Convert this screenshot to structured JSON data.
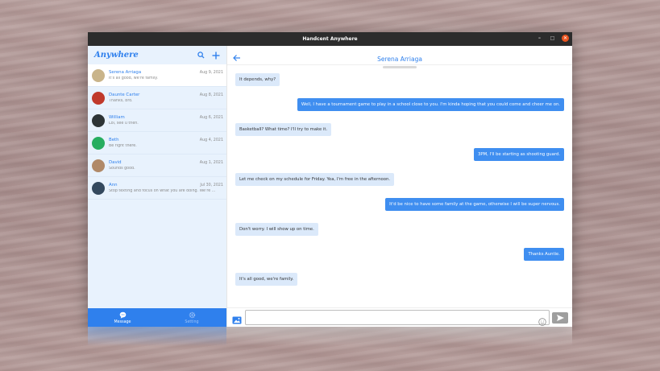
{
  "window": {
    "title": "Handcent Anywhere",
    "controls": [
      "minimize-icon",
      "maximize-icon",
      "close-icon"
    ],
    "close_symbol": "✕",
    "minimize_symbol": "–",
    "maximize_symbol": "□"
  },
  "sidebar": {
    "brand": "Anywhere",
    "search_icon": "search-icon",
    "add_icon": "plus-icon",
    "conversations": [
      {
        "name": "Serena Arriaga",
        "date": "Aug 9, 2021",
        "snippet": "It's all good, we're family.",
        "active": true,
        "avatar_color": "#c9b48a"
      },
      {
        "name": "Daunte Carter",
        "date": "Aug 8, 2021",
        "snippet": "Thanks, bro.",
        "active": false,
        "avatar_color": "#c0392b"
      },
      {
        "name": "William",
        "date": "Aug 6, 2021",
        "snippet": "Lol, see u then.",
        "active": false,
        "avatar_color": "#2d3436"
      },
      {
        "name": "Beth",
        "date": "Aug 4, 2021",
        "snippet": "Be right there.",
        "active": false,
        "avatar_color": "#27ae60"
      },
      {
        "name": "David",
        "date": "Aug 1, 2021",
        "snippet": "Sounds good.",
        "active": false,
        "avatar_color": "#b08968"
      },
      {
        "name": "Ann",
        "date": "Jul 30, 2021",
        "snippet": "Stop texting and focus on what you are doing. We're ...",
        "active": false,
        "avatar_color": "#34495e"
      }
    ]
  },
  "bottom_nav": {
    "tabs": [
      {
        "label": "Message",
        "icon": "chat-bubble-icon",
        "active": true
      },
      {
        "label": "Setting",
        "icon": "gear-icon",
        "active": false
      }
    ]
  },
  "chat": {
    "contact_name": "Serena Arriaga",
    "messages": [
      {
        "direction": "in",
        "text": "It depends, why?"
      },
      {
        "direction": "out",
        "text": "Well, I have a tournament game to play in a school close to you. I'm kinda hoping that you could come and cheer me on."
      },
      {
        "direction": "in",
        "text": "Basketball? What time? I'll try to make it."
      },
      {
        "direction": "out",
        "text": "3PM, I'll be starting as shooting guard."
      },
      {
        "direction": "in",
        "text": "Let me check on my schedule for Friday. Yea, I'm free in the afternoon."
      },
      {
        "direction": "out",
        "text": "It'd be nice to have some family at the game, otherwise I will be super nervous."
      },
      {
        "direction": "in",
        "text": "Don't worry. I will show up on time."
      },
      {
        "direction": "out",
        "text": "Thanks Auntie."
      },
      {
        "direction": "in",
        "text": "It's all good, we're family."
      }
    ],
    "composer": {
      "placeholder": "",
      "value": "",
      "attach_icon": "image-attach-icon",
      "emoji_icon": "emoji-icon",
      "send_icon": "send-icon"
    }
  },
  "colors": {
    "accent": "#2f80ed",
    "sidebar_bg": "#e8f2fd",
    "incoming_bubble": "#dbe9fa",
    "outgoing_bubble": "#3f8ef0",
    "titlebar": "#2c2c2c",
    "close_button": "#e95420"
  }
}
